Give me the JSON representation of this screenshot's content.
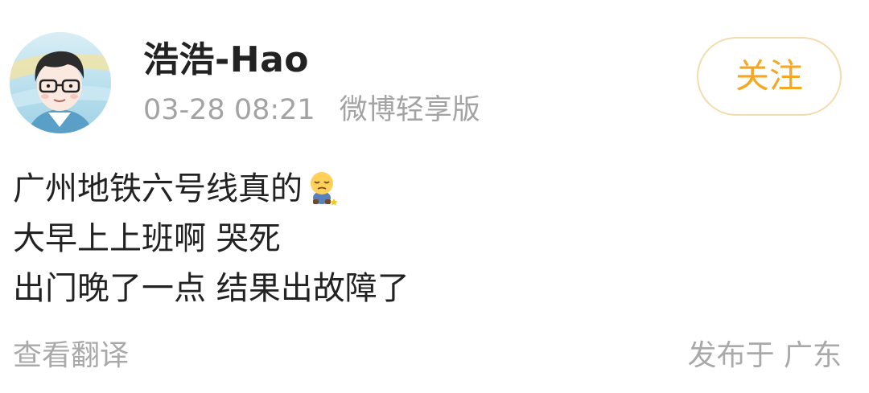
{
  "post": {
    "author": {
      "name": "浩浩-Hao",
      "avatar_icon": "cartoon-boy-with-glasses-avatar"
    },
    "timestamp": "03-28 08:21",
    "source": "微博轻享版",
    "follow_label": "关注",
    "follow_color": "#f5a623",
    "content_lines": [
      "广州地铁六号线真的",
      "大早上上班啊 哭死",
      "出门晚了一点 结果出故障了"
    ],
    "inline_emoji": "sad-sitting-emoji",
    "translate_label": "查看翻译",
    "location_label": "发布于 广东"
  }
}
